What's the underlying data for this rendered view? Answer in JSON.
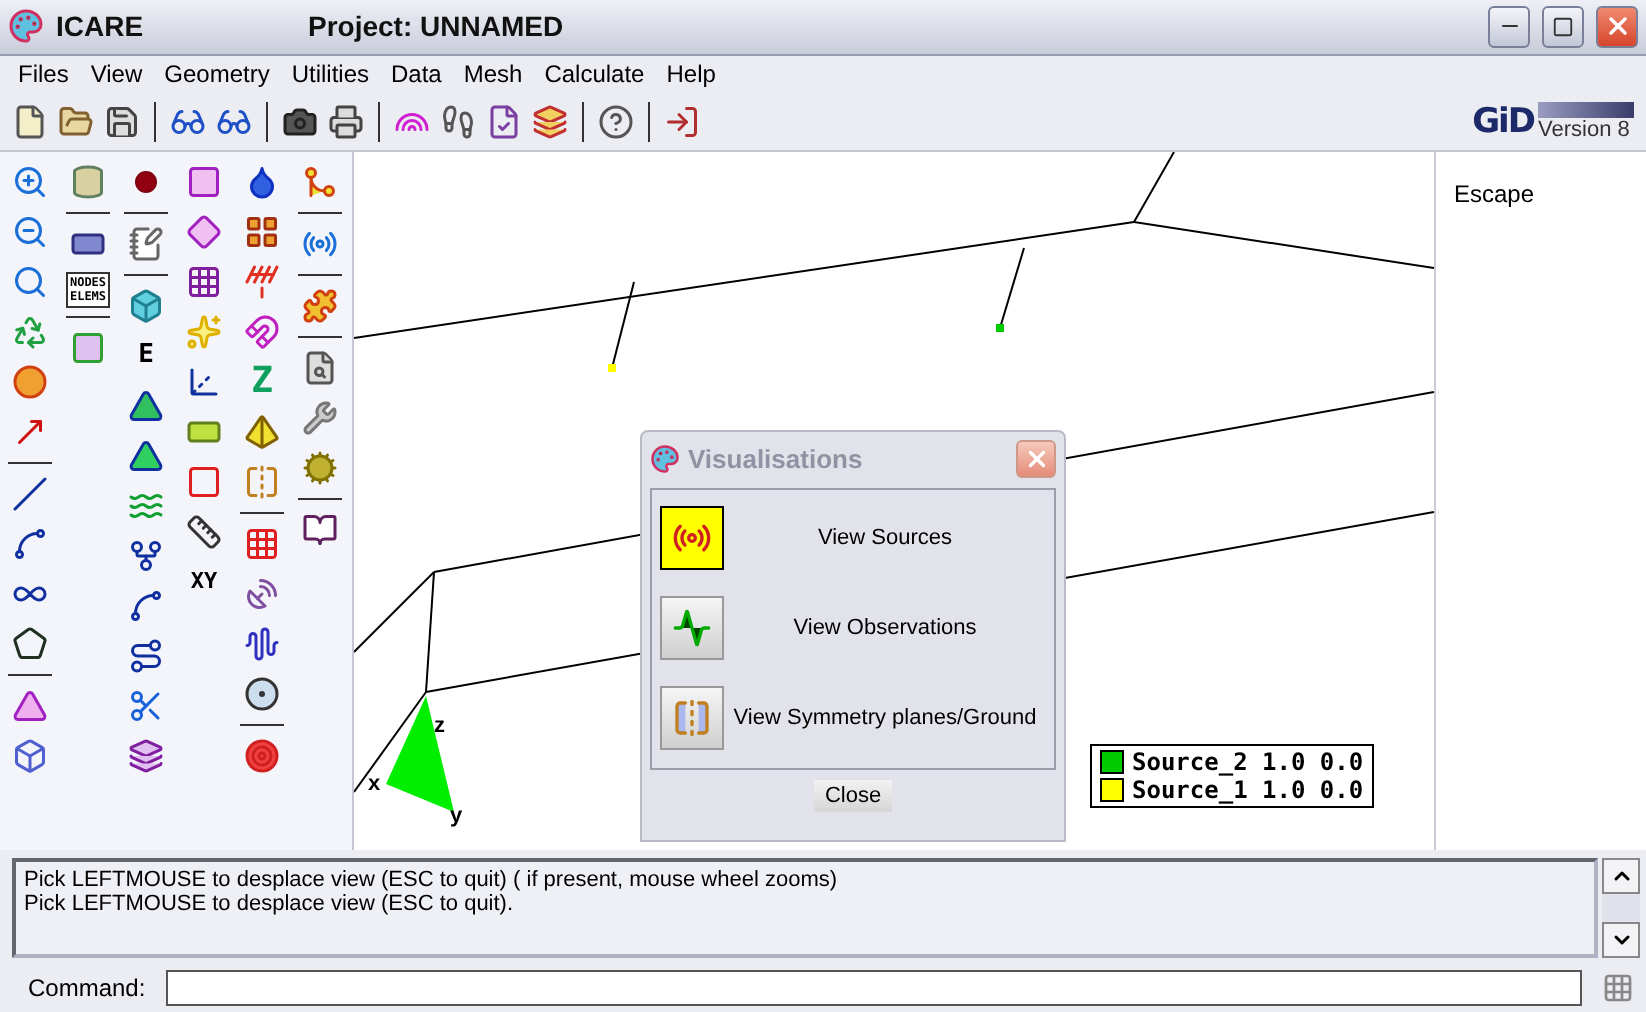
{
  "window": {
    "app_name": "ICARE",
    "title": "Project: UNNAMED"
  },
  "menu": [
    "Files",
    "View",
    "Geometry",
    "Utilities",
    "Data",
    "Mesh",
    "Calculate",
    "Help"
  ],
  "logo": {
    "brand": "GiD",
    "version": "Version 8"
  },
  "palette_labels": {
    "nodes": "NODES",
    "elems": "ELEMS",
    "dimension": "E",
    "z": "Z",
    "xy": "XY"
  },
  "right_panel": {
    "items": [
      "Escape"
    ]
  },
  "axes": {
    "x": "x",
    "y": "y",
    "z": "z"
  },
  "legend": [
    {
      "label": "Source_2 1.0 0.0",
      "color": "#00cc00"
    },
    {
      "label": "Source_1 1.0 0.0",
      "color": "#ffff00"
    }
  ],
  "dialog": {
    "title": "Visualisations",
    "close": "Close",
    "items": [
      {
        "label": "View Sources",
        "kind": "sources",
        "selected": true
      },
      {
        "label": "View Observations",
        "kind": "observations",
        "selected": false
      },
      {
        "label": "View Symmetry planes/Ground",
        "kind": "symmetry",
        "selected": false
      }
    ]
  },
  "log": [
    "Pick LEFTMOUSE to desplace view (ESC to quit) ( if present, mouse wheel zooms)",
    "Pick LEFTMOUSE to desplace view (ESC to quit)."
  ],
  "command": {
    "label": "Command:"
  }
}
